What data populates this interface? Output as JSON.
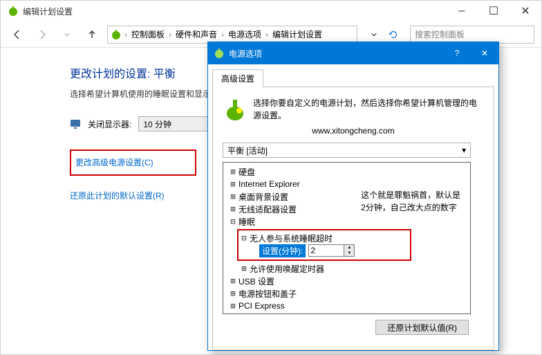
{
  "window": {
    "title": "编辑计划设置",
    "controls": {
      "min": "–",
      "max": "☐",
      "close": "✕"
    }
  },
  "nav": {
    "breadcrumb": [
      "控制面板",
      "硬件和声音",
      "电源选项",
      "编辑计划设置"
    ],
    "search_placeholder": "搜索控制面板"
  },
  "page": {
    "title": "更改计划的设置: 平衡",
    "subtitle": "选择希望计算机使用的睡眠设置和显示",
    "field_label": "关闭显示器:",
    "field_value": "10 分钟",
    "link_advanced": "更改高级电源设置(C)",
    "link_restore": "还原此计划的默认设置(R)"
  },
  "dialog": {
    "title": "电源选项",
    "help": "?",
    "close": "✕",
    "tab": "高级设置",
    "intro": "选择你要自定义的电源计划，然后选择你希望计算机管理的电源设置。",
    "url": "www.xitongcheng.com",
    "plan": "平衡 [活动]",
    "tree": {
      "n0": "硬盘",
      "n1": "Internet Explorer",
      "n2": "桌面背景设置",
      "n3": "无线适配器设置",
      "n4": "睡眠",
      "n4a": "无人参与系统睡眠超时",
      "setting_label": "设置(分钟):",
      "setting_value": "2",
      "n4b": "允许使用唤醒定时器",
      "n5": "USB 设置",
      "n6": "电源按钮和盖子",
      "n7": "PCI Express"
    },
    "annotation_l1": "这个就是罪魁祸首，默认是",
    "annotation_l2": "2分钟，自己改大点的数字",
    "button_restore": "还原计划默认值(R)"
  }
}
